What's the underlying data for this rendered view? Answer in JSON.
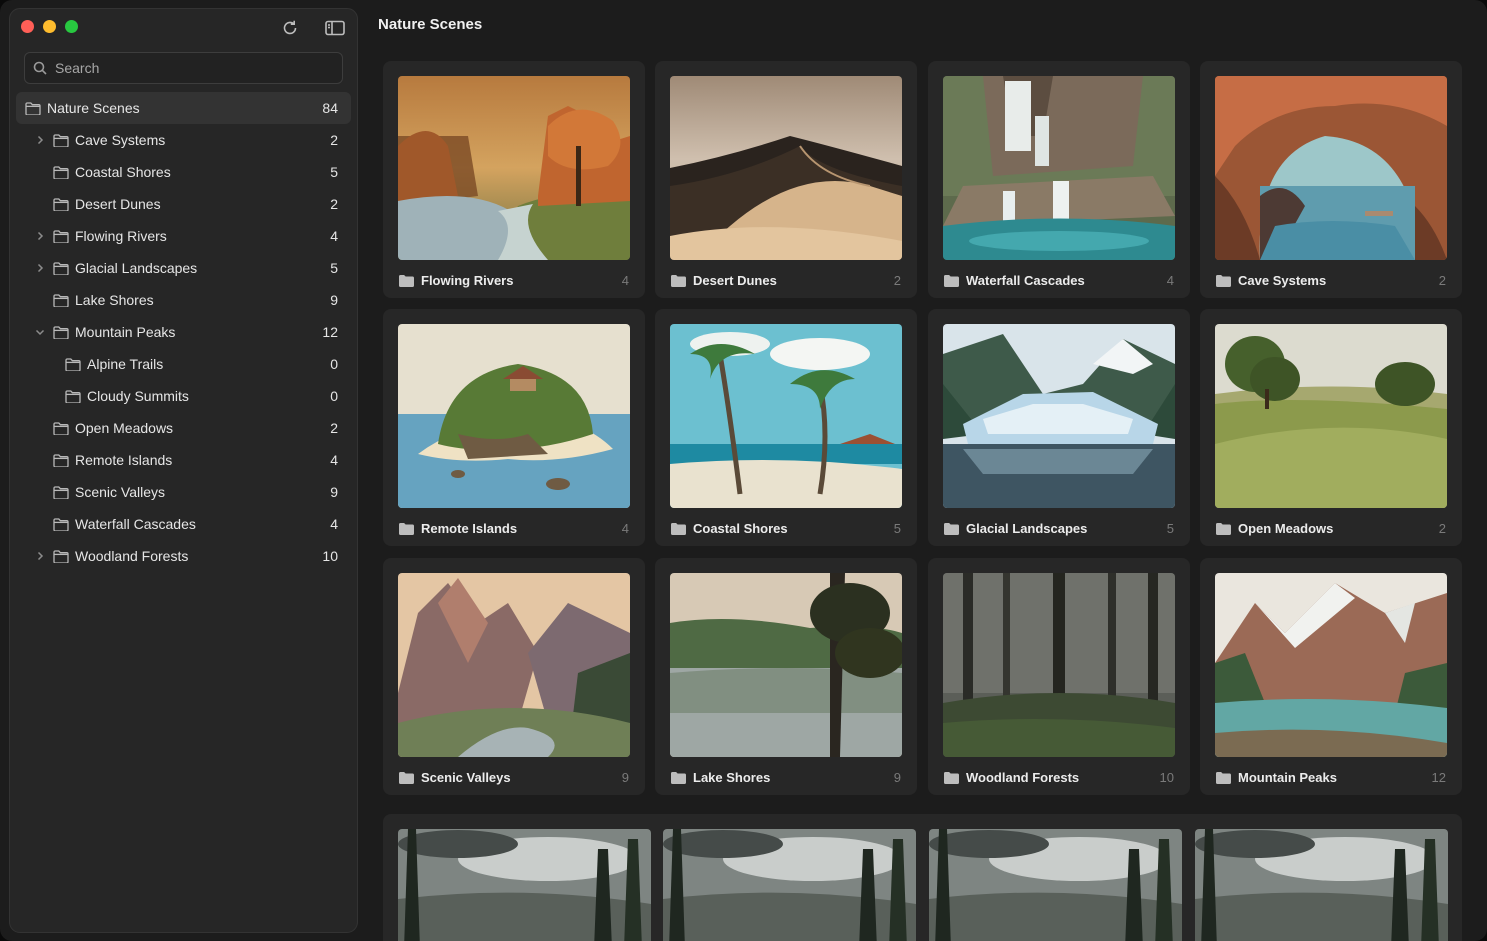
{
  "window": {
    "title": "Nature Scenes"
  },
  "sidebar": {
    "search_placeholder": "Search",
    "tree": [
      {
        "label": "Nature Scenes",
        "count": "84",
        "level": 0,
        "chevron": "none",
        "selected": true
      },
      {
        "label": "Cave Systems",
        "count": "2",
        "level": 1,
        "chevron": "right"
      },
      {
        "label": "Coastal Shores",
        "count": "5",
        "level": 1,
        "chevron": "none"
      },
      {
        "label": "Desert Dunes",
        "count": "2",
        "level": 1,
        "chevron": "none"
      },
      {
        "label": "Flowing Rivers",
        "count": "4",
        "level": 1,
        "chevron": "right"
      },
      {
        "label": "Glacial Landscapes",
        "count": "5",
        "level": 1,
        "chevron": "right"
      },
      {
        "label": "Lake Shores",
        "count": "9",
        "level": 1,
        "chevron": "none"
      },
      {
        "label": "Mountain Peaks",
        "count": "12",
        "level": 1,
        "chevron": "down"
      },
      {
        "label": "Alpine Trails",
        "count": "0",
        "level": 2,
        "chevron": "none"
      },
      {
        "label": "Cloudy Summits",
        "count": "0",
        "level": 2,
        "chevron": "none"
      },
      {
        "label": "Open Meadows",
        "count": "2",
        "level": 1,
        "chevron": "none"
      },
      {
        "label": "Remote Islands",
        "count": "4",
        "level": 1,
        "chevron": "none"
      },
      {
        "label": "Scenic Valleys",
        "count": "9",
        "level": 1,
        "chevron": "none"
      },
      {
        "label": "Waterfall Cascades",
        "count": "4",
        "level": 1,
        "chevron": "none"
      },
      {
        "label": "Woodland Forests",
        "count": "10",
        "level": 1,
        "chevron": "right"
      }
    ]
  },
  "main": {
    "title": "Nature Scenes",
    "cards": [
      {
        "name": "Flowing Rivers",
        "count": "4",
        "scene": "river"
      },
      {
        "name": "Desert Dunes",
        "count": "2",
        "scene": "desert"
      },
      {
        "name": "Waterfall Cascades",
        "count": "4",
        "scene": "waterfall"
      },
      {
        "name": "Cave Systems",
        "count": "2",
        "scene": "cave"
      },
      {
        "name": "Remote Islands",
        "count": "4",
        "scene": "island"
      },
      {
        "name": "Coastal Shores",
        "count": "5",
        "scene": "coast"
      },
      {
        "name": "Glacial Landscapes",
        "count": "5",
        "scene": "glacier"
      },
      {
        "name": "Open Meadows",
        "count": "2",
        "scene": "meadow"
      },
      {
        "name": "Scenic Valleys",
        "count": "9",
        "scene": "valley"
      },
      {
        "name": "Lake Shores",
        "count": "9",
        "scene": "lake"
      },
      {
        "name": "Woodland Forests",
        "count": "10",
        "scene": "forest"
      },
      {
        "name": "Mountain Peaks",
        "count": "12",
        "scene": "mountain"
      }
    ],
    "photos": [
      {
        "scene": "stormy-forest"
      },
      {
        "scene": "stormy-forest"
      },
      {
        "scene": "stormy-forest"
      },
      {
        "scene": "stormy-forest"
      }
    ]
  },
  "icons": {
    "refresh": "refresh-icon",
    "sidebar_toggle": "sidebar-toggle-icon",
    "search": "search-icon",
    "folder": "folder-icon"
  },
  "colors": {
    "window_bg": "#1c1c1c",
    "sidebar_bg": "#262626",
    "card_bg": "#272727",
    "selected_row": "#333333",
    "close": "#ff5f57",
    "minimize": "#febc2e",
    "zoom": "#28c840"
  }
}
